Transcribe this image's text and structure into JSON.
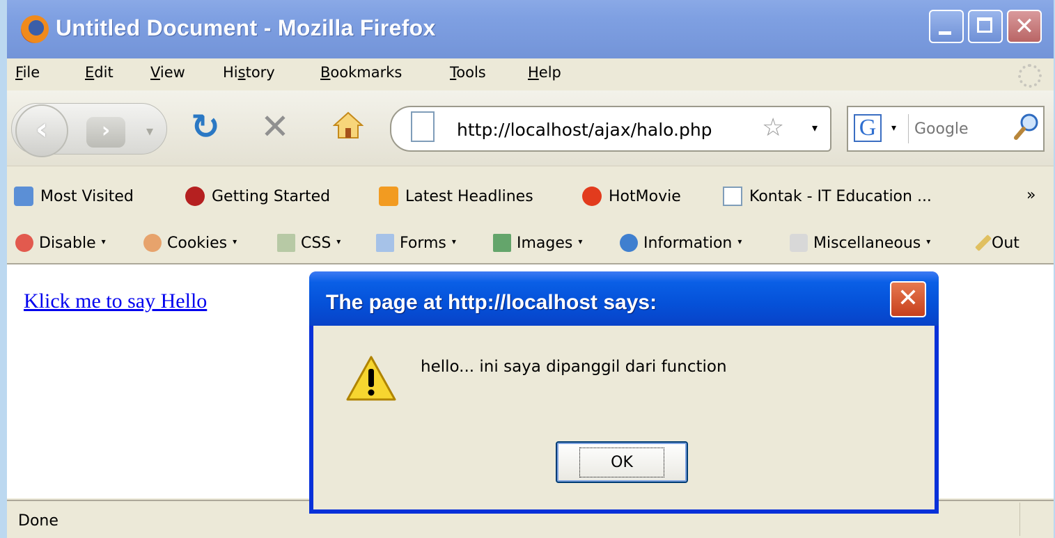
{
  "window": {
    "title": "Untitled Document - Mozilla Firefox",
    "close_glyph": "✕"
  },
  "menu": {
    "items": [
      {
        "prefix": "",
        "ul": "F",
        "rest": "ile"
      },
      {
        "prefix": "",
        "ul": "E",
        "rest": "dit"
      },
      {
        "prefix": "",
        "ul": "V",
        "rest": "iew"
      },
      {
        "prefix": "Hi",
        "ul": "s",
        "rest": "tory"
      },
      {
        "prefix": "",
        "ul": "B",
        "rest": "ookmarks"
      },
      {
        "prefix": "",
        "ul": "T",
        "rest": "ools"
      },
      {
        "prefix": "",
        "ul": "H",
        "rest": "elp"
      }
    ]
  },
  "nav": {
    "back_glyph": "‹",
    "forward_glyph": "›",
    "history_glyph": "▾",
    "reload_glyph": "↻",
    "stop_glyph": "✕",
    "url": "http://localhost/ajax/halo.php",
    "star_glyph": "☆",
    "url_drop_glyph": "▾",
    "search_engine_glyph": "G",
    "search_drop_glyph": "▾",
    "search_placeholder": "Google"
  },
  "bookmarks": {
    "items": [
      {
        "label": "Most Visited",
        "icon": "most-visited-icon",
        "color": "#5b8fd6"
      },
      {
        "label": "Getting Started",
        "icon": "firefox-icon",
        "color": "#b52020"
      },
      {
        "label": "Latest Headlines",
        "icon": "rss-icon",
        "color": "#f29b21"
      },
      {
        "label": "HotMovie",
        "icon": "hotmovie-icon",
        "color": "#e23b1d"
      },
      {
        "label": "Kontak - IT Education ...",
        "icon": "page-icon",
        "color": "#ffffff"
      }
    ],
    "overflow": "»"
  },
  "webdev": {
    "items": [
      {
        "label": "Disable",
        "icon": "disable-icon",
        "color": "#e25a4e"
      },
      {
        "label": "Cookies",
        "icon": "cookies-icon",
        "color": "#e7a36c"
      },
      {
        "label": "CSS",
        "icon": "css-icon",
        "color": "#b7c9a5"
      },
      {
        "label": "Forms",
        "icon": "forms-icon",
        "color": "#a6c2e8"
      },
      {
        "label": "Images",
        "icon": "images-icon",
        "color": "#64a56b"
      },
      {
        "label": "Information",
        "icon": "information-icon",
        "color": "#3f7fcf"
      },
      {
        "label": "Miscellaneous",
        "icon": "miscellaneous-icon",
        "color": "#d8d8d8"
      },
      {
        "label": "Out",
        "icon": "outline-icon",
        "color": "#e0c060"
      }
    ],
    "caret": "▾"
  },
  "page": {
    "link_text": "Klick me to say Hello"
  },
  "dialog": {
    "title": "The page at http://localhost says:",
    "message": "hello... ini saya dipanggil dari function",
    "ok_label": "OK",
    "close_glyph": "✕"
  },
  "status": {
    "text": "Done"
  },
  "colors": {
    "titlebar": "#7a9ae0",
    "dialog_title": "#0551d8",
    "link": "#0000ee"
  }
}
